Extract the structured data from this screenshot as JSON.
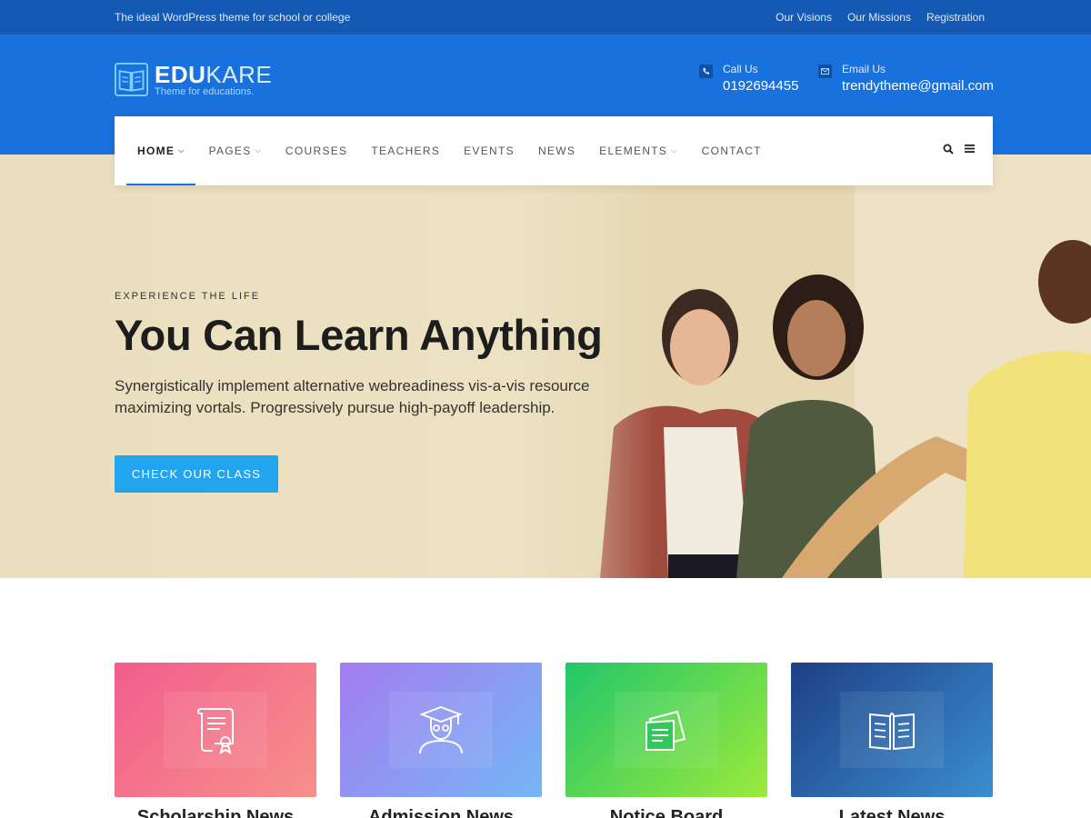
{
  "topbar": {
    "tagline": "The ideal WordPress theme for school or college",
    "links": [
      "Our Visions",
      "Our Missions",
      "Registration"
    ]
  },
  "header": {
    "logo_bold": "EDU",
    "logo_light": "KARE",
    "logo_sub": "Theme for educations.",
    "phone_label": "Call Us",
    "phone_value": "0192694455",
    "email_label": "Email Us",
    "email_value": "trendytheme@gmail.com"
  },
  "nav": {
    "items": [
      "HOME",
      "PAGES",
      "COURSES",
      "TEACHERS",
      "EVENTS",
      "NEWS",
      "ELEMENTS",
      "CONTACT"
    ],
    "active": "HOME"
  },
  "hero": {
    "kicker": "EXPERIENCE THE LIFE",
    "title": "You Can Learn Anything",
    "text": "Synergistically implement alternative webreadiness vis-a-vis resource maximizing vortals. Progressively pursue high-payoff leadership.",
    "cta": "CHECK OUR CLASS"
  },
  "cards": [
    {
      "icon": "certificate-icon",
      "title": "Scholarship News"
    },
    {
      "icon": "graduate-icon",
      "title": "Admission News"
    },
    {
      "icon": "notice-board-icon",
      "title": "Notice Board"
    },
    {
      "icon": "book-icon",
      "title": "Latest News"
    }
  ],
  "colors": {
    "topbar": "#1459b3",
    "header": "#1971dd",
    "accent": "#22a5ee",
    "hero_bg": "#ece2c3"
  }
}
